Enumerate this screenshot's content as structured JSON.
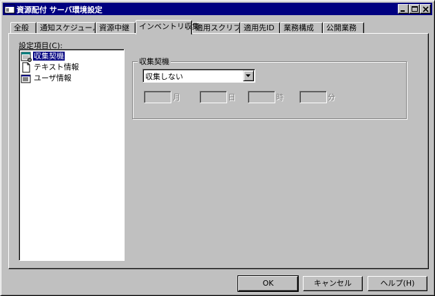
{
  "window": {
    "title": "資源配付 サーバ環境設定"
  },
  "tabs": [
    {
      "label": "全般"
    },
    {
      "label": "通知スケジュール"
    },
    {
      "label": "資源中継"
    },
    {
      "label": "インベントリ収集",
      "selected": true
    },
    {
      "label": "適用スクリプト"
    },
    {
      "label": "適用先ID"
    },
    {
      "label": "業務構成"
    },
    {
      "label": "公開業務"
    }
  ],
  "settings": {
    "label": "設定項目(C):",
    "items": [
      {
        "label": "収集契機",
        "icon": "calendar-icon",
        "selected": true
      },
      {
        "label": "テキスト情報",
        "icon": "document-icon"
      },
      {
        "label": "ユーザ情報",
        "icon": "user-list-icon"
      }
    ]
  },
  "collection": {
    "group_title": "収集契機",
    "select_value": "収集しない",
    "units": {
      "month": "月",
      "day": "日",
      "hour": "時",
      "minute": "分"
    }
  },
  "buttons": {
    "ok": "OK",
    "cancel": "キャンセル",
    "help": "ヘルプ(H)"
  }
}
